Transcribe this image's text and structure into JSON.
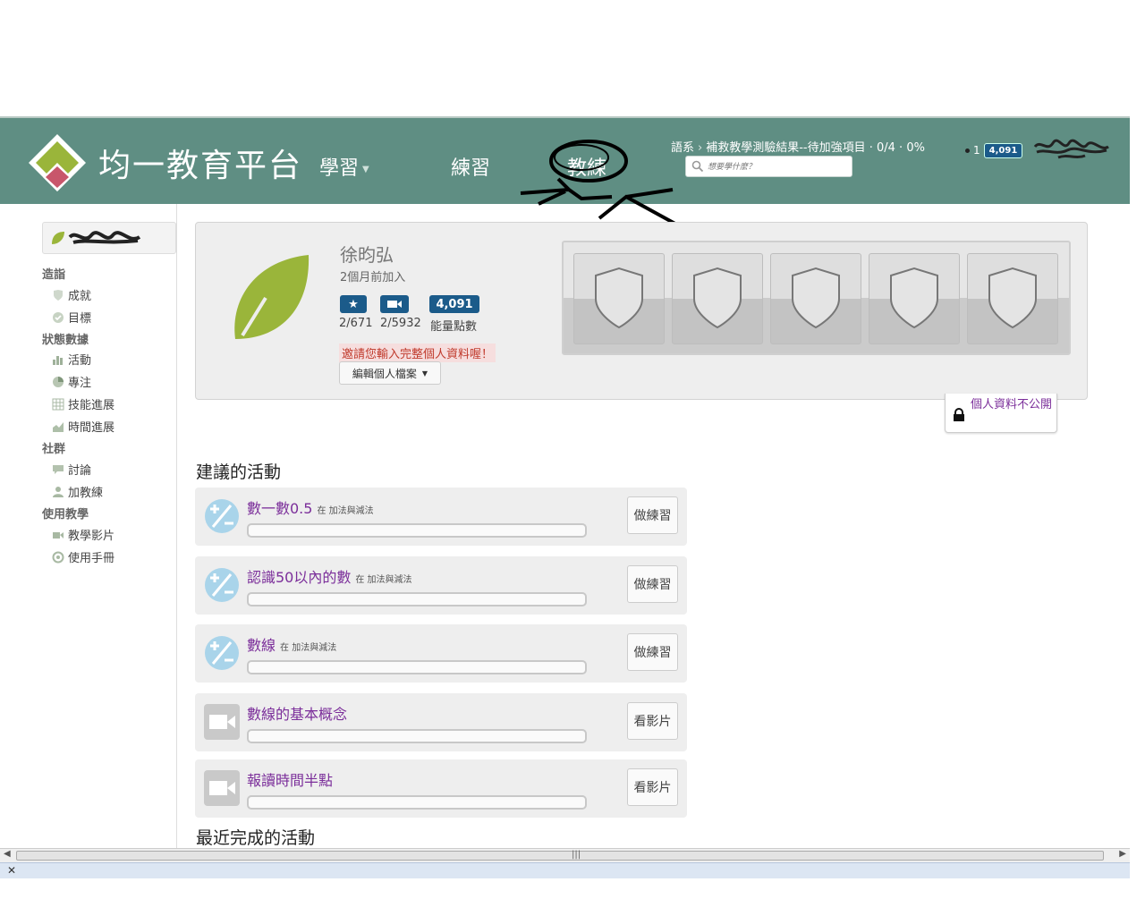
{
  "header": {
    "logo_text": "均一教育平台",
    "nav": {
      "learn": "學習",
      "practice": "練習",
      "coach": "教練"
    },
    "breadcrumb": {
      "part1": "語系",
      "part2": "補救教學測驗結果--待加強項目 · 0/4 · 0%"
    },
    "search_placeholder": "想要學什麼？",
    "user": {
      "streak": "1",
      "points": "4,091"
    }
  },
  "sidebar": {
    "sections": [
      {
        "title": "造詣",
        "items": [
          "成就",
          "目標"
        ]
      },
      {
        "title": "狀態數據",
        "items": [
          "活動",
          "專注",
          "技能進展",
          "時間進展"
        ]
      },
      {
        "title": "社群",
        "items": [
          "討論",
          "加教練"
        ]
      },
      {
        "title": "使用教學",
        "items": [
          "教學影片",
          "使用手冊"
        ]
      }
    ]
  },
  "profile": {
    "name": "徐昀弘",
    "joined": "2個月前加入",
    "stats": {
      "exercises": "2/671",
      "videos": "2/5932",
      "points": "4,091",
      "points_label": "能量點數"
    },
    "warning": "邀請您輸入完整個人資料喔！",
    "edit_label": "編輯個人檔案",
    "privacy": "個人資料不公開"
  },
  "recommended": {
    "title": "建議的活動",
    "items": [
      {
        "type": "exercise",
        "title": "數一數0.5",
        "sub": "在 加法與減法",
        "button": "做練習",
        "progress": 0
      },
      {
        "type": "exercise",
        "title": "認識50以內的數",
        "sub": "在 加法與減法",
        "button": "做練習",
        "progress": 0
      },
      {
        "type": "exercise",
        "title": "數線",
        "sub": "在 加法與減法",
        "button": "做練習",
        "progress": 0
      },
      {
        "type": "video",
        "title": "數線的基本概念",
        "sub": "",
        "button": "看影片",
        "progress": 0
      },
      {
        "type": "video",
        "title": "報讀時間半點",
        "sub": "",
        "button": "看影片",
        "progress": 0
      }
    ]
  },
  "recent_title": "最近完成的活動",
  "colors": {
    "header_bg": "#5f8e83",
    "accent_purple": "#7b2e9a",
    "badge_blue": "#1b5b8a",
    "leaf_green": "#9ab53a"
  }
}
